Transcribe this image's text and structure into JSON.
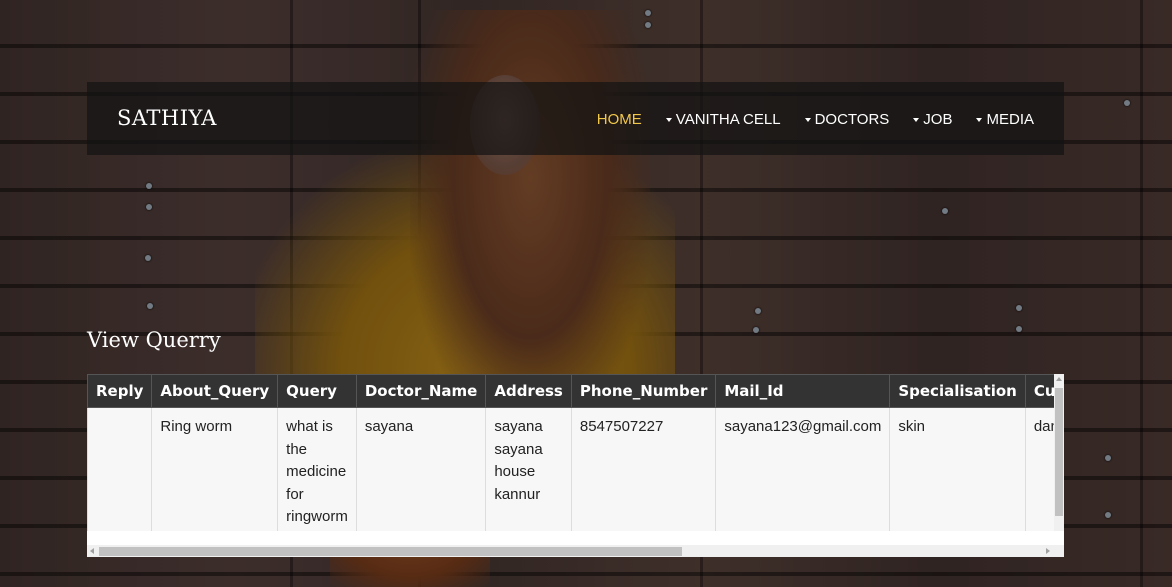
{
  "brand": "SATHIYA",
  "nav": {
    "home": "HOME",
    "vanitha_cell": "VANITHA CELL",
    "doctors": "DOCTORS",
    "job": "JOB",
    "media": "MEDIA"
  },
  "section_title": "View Querry",
  "table": {
    "headers": [
      "Reply",
      "About_Query",
      "Query",
      "Doctor_Name",
      "Address",
      "Phone_Number",
      "Mail_Id",
      "Specialisation",
      "Curre"
    ],
    "rows": [
      {
        "reply": "",
        "about_query": "Ring worm",
        "query": "what is the medicine for ringworm",
        "doctor_name": "sayana",
        "address": "sayana sayana house kannur",
        "phone_number": "8547507227",
        "mail_id": "sayana123@gmail.com",
        "specialisation": "skin",
        "current": "danala"
      }
    ]
  },
  "colors": {
    "accent": "#f2c84b",
    "navbar_bg": "#141414",
    "table_header_bg": "#333333"
  }
}
